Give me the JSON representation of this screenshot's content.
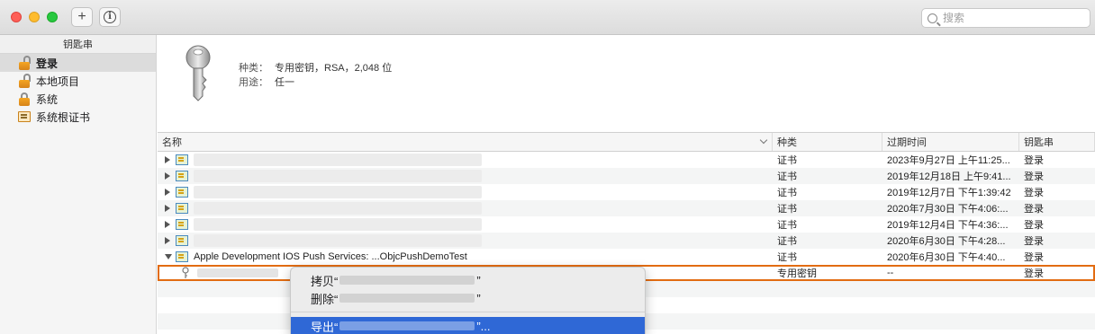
{
  "toolbar": {
    "add_label": "+",
    "info_label": "i",
    "search_placeholder": "搜索"
  },
  "sidebar": {
    "header": "钥匙串",
    "items": [
      {
        "label": "登录",
        "icon": "open-lock-icon",
        "selected": true
      },
      {
        "label": "本地项目",
        "icon": "open-lock-icon",
        "selected": false
      },
      {
        "label": "系统",
        "icon": "lock-icon",
        "selected": false
      },
      {
        "label": "系统根证书",
        "icon": "certificate-folder-icon",
        "selected": false
      }
    ]
  },
  "details": {
    "icon": "key-icon",
    "rows": [
      {
        "label": "种类：",
        "value": "专用密钥，RSA，2,048 位"
      },
      {
        "label": "用途：",
        "value": "任一"
      }
    ]
  },
  "table": {
    "columns": [
      "名称",
      "种类",
      "过期时间",
      "钥匙串"
    ],
    "rows": [
      {
        "name": "",
        "kind": "证书",
        "expires": "2023年9月27日 上午11:25...",
        "keychain": "登录"
      },
      {
        "name": "",
        "kind": "证书",
        "expires": "2019年12月18日 上午9:41...",
        "keychain": "登录"
      },
      {
        "name": "",
        "kind": "证书",
        "expires": "2019年12月7日 下午1:39:42",
        "keychain": "登录"
      },
      {
        "name": "",
        "kind": "证书",
        "expires": "2020年7月30日 下午4:06:...",
        "keychain": "登录"
      },
      {
        "name": "",
        "kind": "证书",
        "expires": "2019年12月4日 下午4:36:...",
        "keychain": "登录"
      },
      {
        "name": "",
        "kind": "证书",
        "expires": "2020年6月30日 下午4:28...",
        "keychain": "登录"
      },
      {
        "name": "Apple Development IOS Push Services: ...ObjcPushDemoTest",
        "kind": "证书",
        "expires": "2020年6月30日 下午4:40...",
        "keychain": "登录"
      },
      {
        "name": "",
        "kind": "专用密钥",
        "expires": "--",
        "keychain": "登录"
      }
    ]
  },
  "context_menu": {
    "items": [
      {
        "prefix": "拷贝“",
        "suffix": "”"
      },
      {
        "prefix": "删除“",
        "suffix": "”"
      },
      {
        "prefix": "导出“",
        "suffix": "”..."
      }
    ]
  },
  "colors": {
    "highlight_outline": "#e26c12",
    "menu_selection": "#2f68d6"
  }
}
